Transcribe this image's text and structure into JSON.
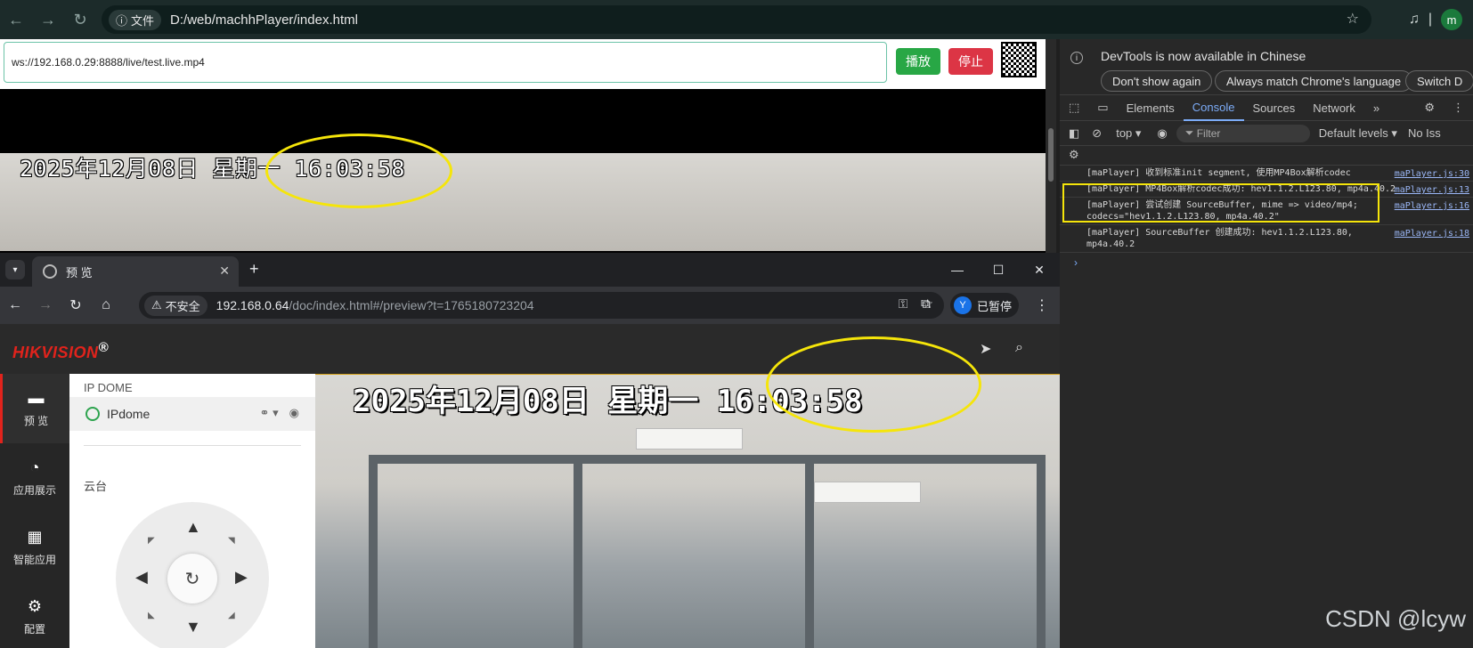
{
  "outer_browser": {
    "chip_label": "文件",
    "url": "D:/web/machhPlayer/index.html",
    "profile_initial": "m"
  },
  "player": {
    "ws_url": "ws://192.168.0.29:8888/live/test.live.mp4",
    "play_label": "播放",
    "stop_label": "停止",
    "osd_text": "2025年12月08日 星期一 16:03:58"
  },
  "devtools": {
    "banner_message": "DevTools is now available in Chinese",
    "btn_dont_show": "Don't show again",
    "btn_match_lang": "Always match Chrome's language",
    "btn_switch": "Switch D",
    "tabs": [
      "Elements",
      "Console",
      "Sources",
      "Network"
    ],
    "active_tab": "Console",
    "context": "top",
    "filter_placeholder": "Filter",
    "levels": "Default levels",
    "issues": "No Iss",
    "logs": [
      {
        "text": "[maPlayer] 收到标准init segment, 使用MP4Box解析codec",
        "src": "maPlayer.js:30"
      },
      {
        "text": "[maPlayer] MP4Box解析codec成功: hev1.1.2.L123.80, mp4a.40.2",
        "src": "maPlayer.js:13"
      },
      {
        "text": "[maPlayer] 尝试创建 SourceBuffer, mime => video/mp4; codecs=\"hev1.1.2.L123.80, mp4a.40.2\"",
        "src": "maPlayer.js:16"
      },
      {
        "text": "[maPlayer] SourceBuffer 创建成功: hev1.1.2.L123.80, mp4a.40.2",
        "src": "maPlayer.js:18"
      }
    ]
  },
  "inner_browser": {
    "tab_title": "预 览",
    "unsafe_label": "不安全",
    "url_host": "192.168.0.64",
    "url_path": "/doc/index.html#/preview?t=1765180723204",
    "profile_initial": "Y",
    "profile_status": "已暂停"
  },
  "hikvision": {
    "logo_main": "HIKVISION",
    "logo_mark": "®",
    "nav": [
      {
        "label": "预 览"
      },
      {
        "label": "应用展示"
      },
      {
        "label": "智能应用"
      },
      {
        "label": "配置"
      }
    ],
    "device_group": "IP DOME",
    "device_name": "IPdome",
    "ptz_label": "云台",
    "osd_text": "2025年12月08日 星期一 16:03:58"
  },
  "watermark": "CSDN @lcyw",
  "colors": {
    "highlight": "#f5e50a",
    "hik_red": "#e1231c",
    "play_green": "#28a745",
    "stop_red": "#dc3545"
  }
}
